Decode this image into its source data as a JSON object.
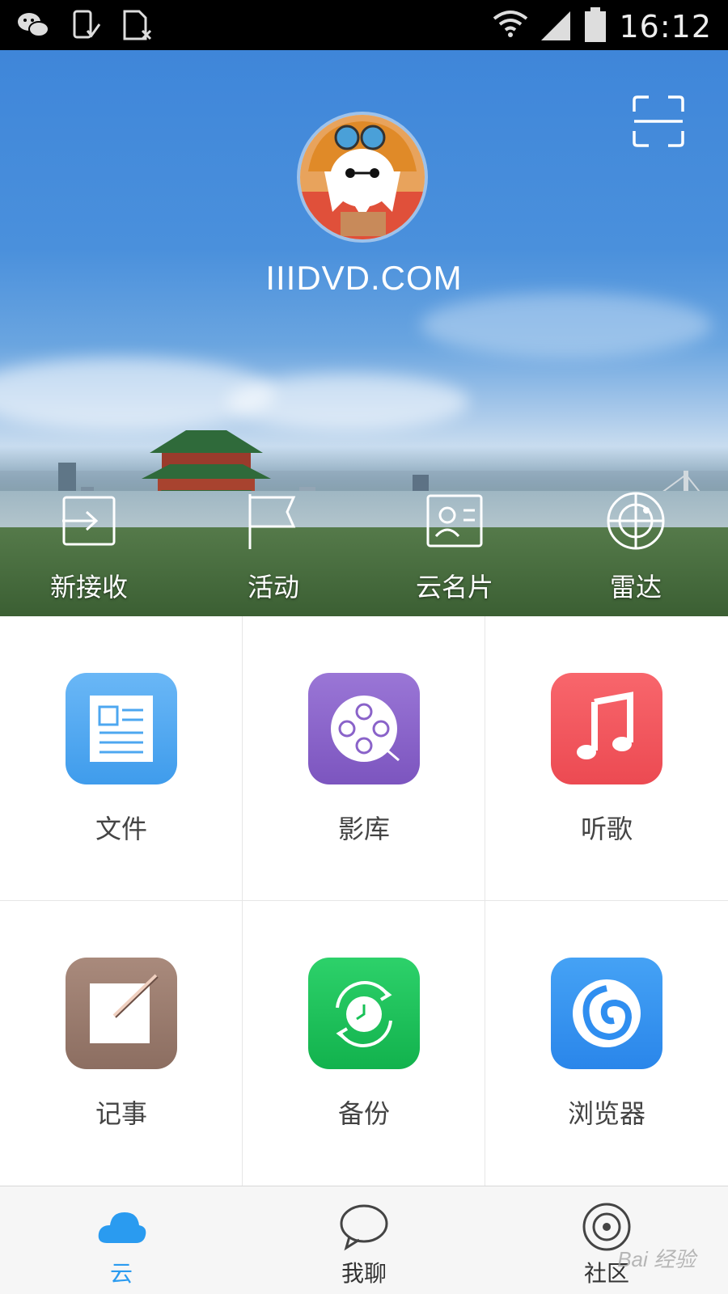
{
  "status_bar": {
    "time": "16:12",
    "icons": [
      "wechat-icon",
      "phone-check-icon",
      "sim-blocked-icon",
      "wifi-icon",
      "signal-icon",
      "battery-icon"
    ]
  },
  "header": {
    "username": "IIIDVD.COM",
    "avatar_icon": "avatar-image",
    "scan_icon": "scan-icon"
  },
  "quick_actions": [
    {
      "label": "新接收",
      "icon": "receive-arrow-icon"
    },
    {
      "label": "活动",
      "icon": "flag-icon"
    },
    {
      "label": "云名片",
      "icon": "contact-card-icon"
    },
    {
      "label": "雷达",
      "icon": "radar-icon"
    }
  ],
  "apps": [
    {
      "label": "文件",
      "icon": "document-icon",
      "color": "#4da7f0"
    },
    {
      "label": "影库",
      "icon": "film-reel-icon",
      "color": "#8a63c9"
    },
    {
      "label": "听歌",
      "icon": "music-note-icon",
      "color": "#f2535a"
    },
    {
      "label": "记事",
      "icon": "note-pen-icon",
      "color": "#9a7a6c"
    },
    {
      "label": "备份",
      "icon": "backup-clock-icon",
      "color": "#18c157"
    },
    {
      "label": "浏览器",
      "icon": "browser-swirl-icon",
      "color": "#2f8ef0"
    }
  ],
  "bottom_nav": [
    {
      "label": "云",
      "icon": "cloud-icon",
      "active": true
    },
    {
      "label": "我聊",
      "icon": "chat-bubble-icon",
      "active": false
    },
    {
      "label": "社区",
      "icon": "community-icon",
      "active": false
    }
  ],
  "colors": {
    "accent": "#2a9bf0",
    "header_blue": "#4a90dc"
  },
  "watermark": "Bai 经验"
}
